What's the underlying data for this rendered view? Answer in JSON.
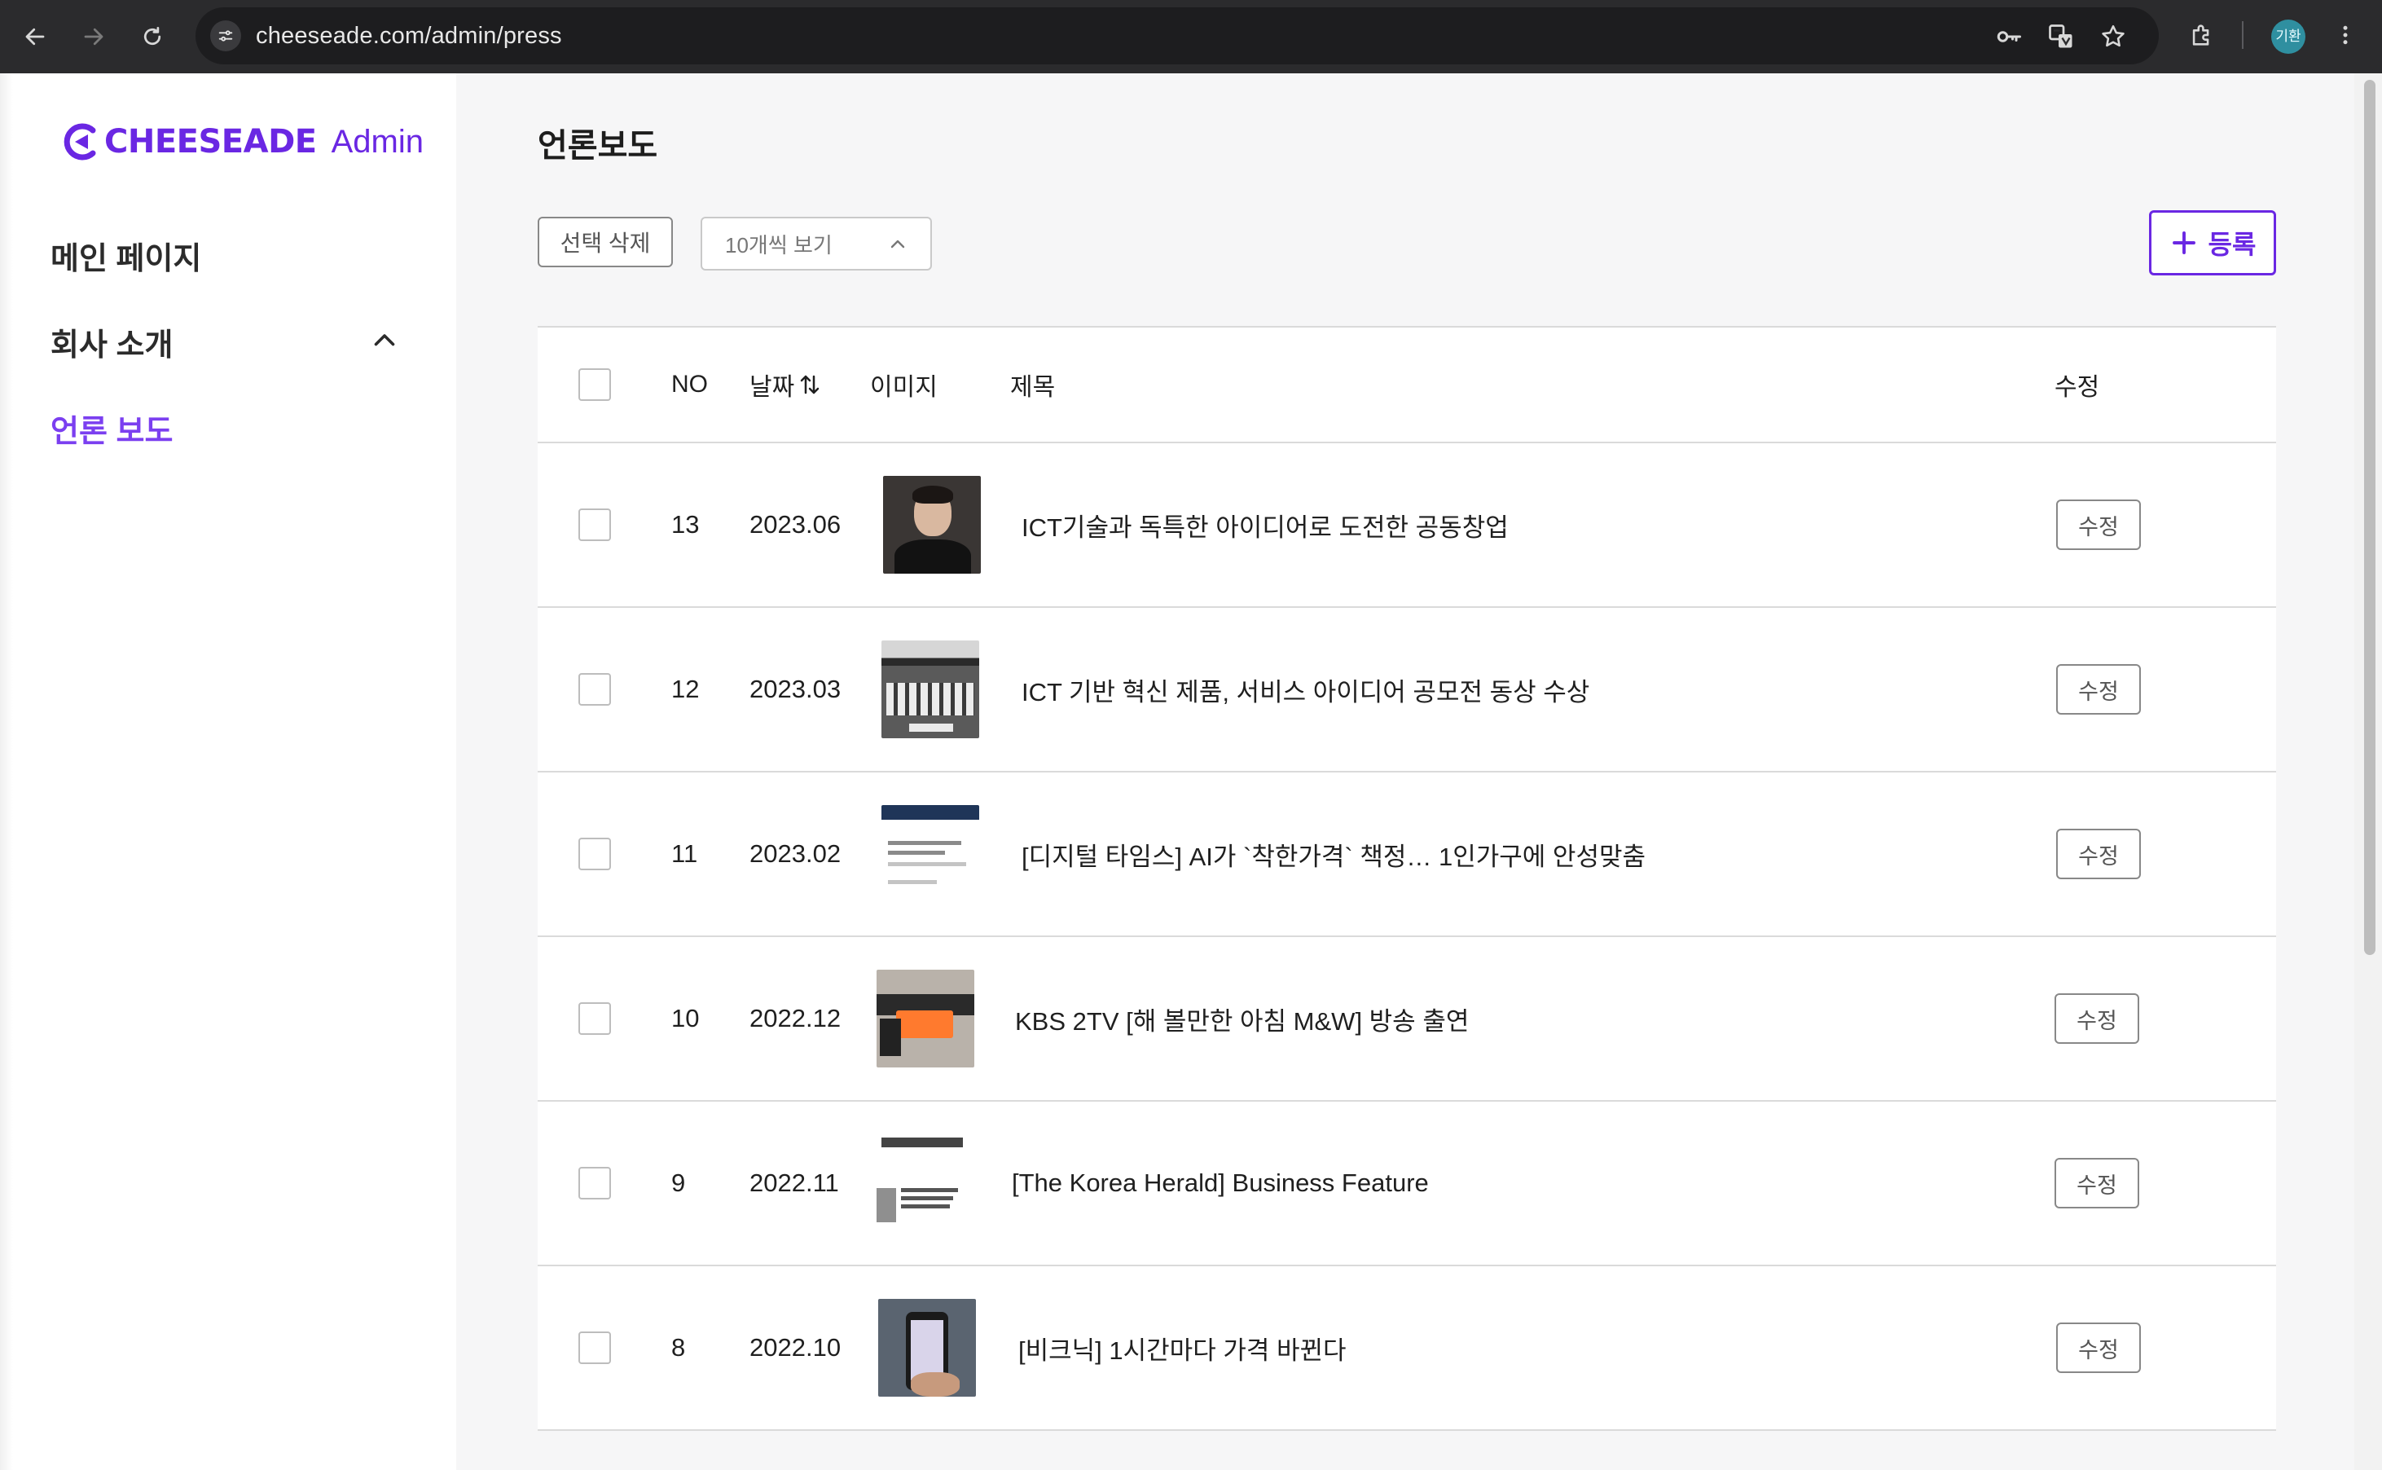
{
  "browser": {
    "url": "cheeseade.com/admin/press",
    "avatar_text": "기환"
  },
  "sidebar": {
    "logo_text": "CHEESEADE",
    "logo_sub": "Admin",
    "items": [
      {
        "label": "메인 페이지"
      },
      {
        "label": "회사 소개"
      },
      {
        "label": "언론 보도"
      }
    ]
  },
  "main": {
    "title": "언론보도",
    "delete_selected": "선택 삭제",
    "page_size": "10개씩 보기",
    "register": "등록",
    "table": {
      "headers": {
        "no": "NO",
        "date": "날짜",
        "image": "이미지",
        "title": "제목",
        "edit": "수정"
      },
      "rows": [
        {
          "no": "13",
          "date": "2023.06",
          "title": "ICT기술과 독특한 아이디어로 도전한 공동창업",
          "edit": "수정"
        },
        {
          "no": "12",
          "date": "2023.03",
          "title": "ICT 기반 혁신 제품, 서비스 아이디어 공모전 동상 수상",
          "edit": "수정"
        },
        {
          "no": "11",
          "date": "2023.02",
          "title": "[디지털 타임스] AI가 `착한가격` 책정… 1인가구에 안성맞춤",
          "edit": "수정"
        },
        {
          "no": "10",
          "date": "2022.12",
          "title": "KBS 2TV [해 볼만한 아침 M&W] 방송 출연",
          "edit": "수정"
        },
        {
          "no": "9",
          "date": "2022.11",
          "title": "[The Korea Herald] Business Feature",
          "edit": "수정"
        },
        {
          "no": "8",
          "date": "2022.10",
          "title": "[비크닉] 1시간마다 가격 바뀐다",
          "edit": "수정"
        }
      ]
    }
  },
  "colors": {
    "brand": "#6a27e3",
    "active_nav": "#7b3ff0"
  }
}
